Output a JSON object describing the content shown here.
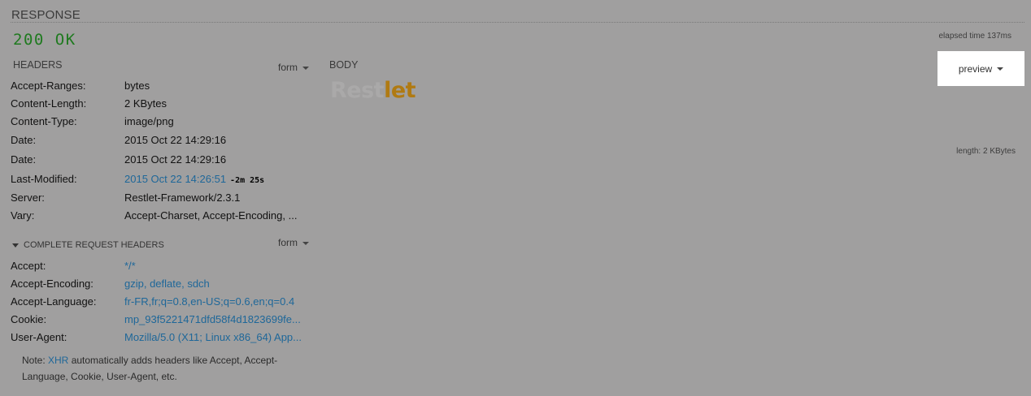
{
  "response": {
    "title": "RESPONSE",
    "status": "200 OK",
    "elapsed": "elapsed time 137ms",
    "length": "length: 2 KBytes"
  },
  "headers": {
    "title": "HEADERS",
    "mode": "form",
    "rows": [
      {
        "key": "Accept-Ranges:",
        "value": "bytes"
      },
      {
        "key": "Content-Length:",
        "value": "2 KBytes"
      },
      {
        "key": "Content-Type:",
        "value": "image/png"
      },
      {
        "key": "Date:",
        "value": "2015 Oct 22 14:29:16"
      },
      {
        "key": "Date:",
        "value": "2015 Oct 22 14:29:16"
      },
      {
        "key": "Last-Modified:",
        "value": "2015 Oct 22 14:26:51",
        "delta": "-2m 25s"
      },
      {
        "key": "Server:",
        "value": "Restlet-Framework/2.3.1"
      },
      {
        "key": "Vary:",
        "value": "Accept-Charset, Accept-Encoding, ..."
      }
    ]
  },
  "body": {
    "title": "BODY",
    "view_mode": "preview",
    "logo_part1": "Rest",
    "logo_part2": "let"
  },
  "request_headers": {
    "title": "COMPLETE REQUEST HEADERS",
    "mode": "form",
    "rows": [
      {
        "key": "Accept:",
        "value": "*/*"
      },
      {
        "key": "Accept-Encoding:",
        "value": "gzip, deflate, sdch"
      },
      {
        "key": "Accept-Language:",
        "value": "fr-FR,fr;q=0.8,en-US;q=0.6,en;q=0.4"
      },
      {
        "key": "Cookie:",
        "value": "mp_93f5221471dfd58f4d1823699fe..."
      },
      {
        "key": "User-Agent:",
        "value": "Mozilla/5.0 (X11; Linux x86_64) App..."
      }
    ]
  },
  "note": {
    "prefix": "Note: ",
    "link": "XHR",
    "suffix": " automatically adds headers like Accept, Accept-Language, Cookie, User-Agent, etc."
  },
  "colors": {
    "status_ok": "#1f7a1f",
    "link": "#1e6799",
    "logo_accent": "#b07a12"
  }
}
